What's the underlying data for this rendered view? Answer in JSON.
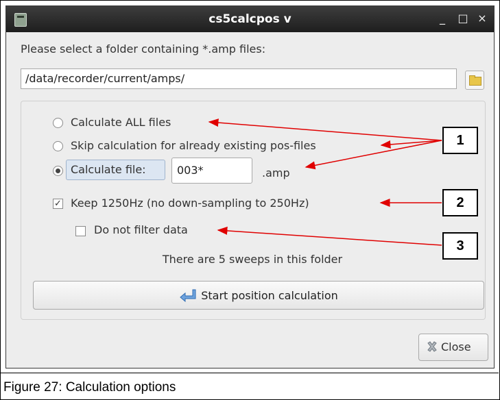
{
  "window": {
    "title": "cs5calcpos v",
    "minimize": "_",
    "maximize": "□",
    "close": "×"
  },
  "folder": {
    "label": "Please select a folder containing *.amp files:",
    "path": "/data/recorder/current/amps/"
  },
  "options": {
    "all_files": "Calculate ALL files",
    "skip_existing": "Skip calculation for already existing pos-files",
    "calc_file": "Calculate file:",
    "file_value": "003*",
    "file_ext": ".amp",
    "keep_1250": "Keep 1250Hz (no down-sampling to 250Hz)",
    "no_filter": "Do not filter data",
    "selected_radio": "calc_file",
    "keep_1250_checked": true,
    "no_filter_checked": false
  },
  "status": {
    "sweeps": "There are 5 sweeps in this folder"
  },
  "buttons": {
    "start": "Start position calculation",
    "close": "Close"
  },
  "annotations": {
    "box1": "1",
    "box2": "2",
    "box3": "3",
    "arrow_color": "#e00000"
  },
  "caption": "Figure 27:  Calculation options"
}
